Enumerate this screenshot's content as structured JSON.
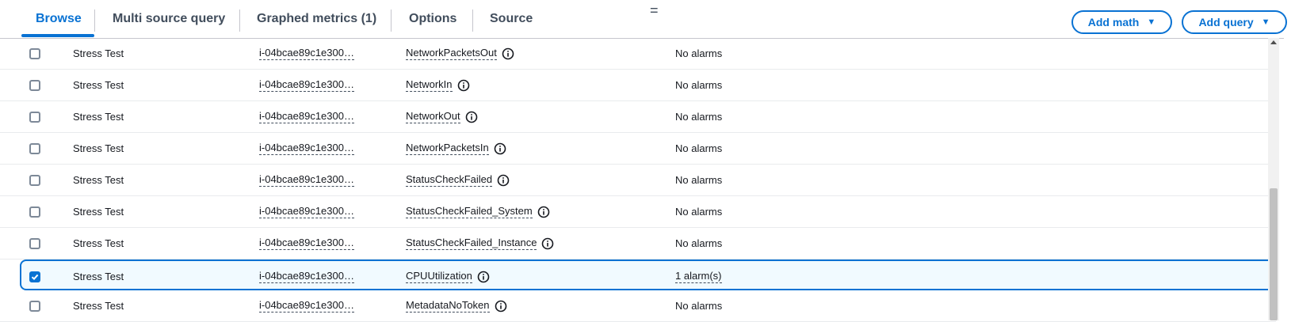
{
  "tabs": [
    {
      "label": "Browse",
      "active": true
    },
    {
      "label": "Multi source query",
      "active": false
    },
    {
      "label": "Graphed metrics (1)",
      "active": false
    },
    {
      "label": "Options",
      "active": false
    },
    {
      "label": "Source",
      "active": false
    }
  ],
  "drag_handle": "=",
  "buttons": {
    "add_math": "Add math",
    "add_query": "Add query",
    "caret": "▼"
  },
  "rows": [
    {
      "checked": false,
      "name": "Stress Test",
      "instance": "i-04bcae89c1e300…",
      "metric": "NetworkPacketsOut",
      "alarms": "No alarms"
    },
    {
      "checked": false,
      "name": "Stress Test",
      "instance": "i-04bcae89c1e300…",
      "metric": "NetworkIn",
      "alarms": "No alarms"
    },
    {
      "checked": false,
      "name": "Stress Test",
      "instance": "i-04bcae89c1e300…",
      "metric": "NetworkOut",
      "alarms": "No alarms"
    },
    {
      "checked": false,
      "name": "Stress Test",
      "instance": "i-04bcae89c1e300…",
      "metric": "NetworkPacketsIn",
      "alarms": "No alarms"
    },
    {
      "checked": false,
      "name": "Stress Test",
      "instance": "i-04bcae89c1e300…",
      "metric": "StatusCheckFailed",
      "alarms": "No alarms"
    },
    {
      "checked": false,
      "name": "Stress Test",
      "instance": "i-04bcae89c1e300…",
      "metric": "StatusCheckFailed_System",
      "alarms": "No alarms"
    },
    {
      "checked": false,
      "name": "Stress Test",
      "instance": "i-04bcae89c1e300…",
      "metric": "StatusCheckFailed_Instance",
      "alarms": "No alarms"
    },
    {
      "checked": true,
      "name": "Stress Test",
      "instance": "i-04bcae89c1e300…",
      "metric": "CPUUtilization",
      "alarms": "1 alarm(s)"
    },
    {
      "checked": false,
      "name": "Stress Test",
      "instance": "i-04bcae89c1e300…",
      "metric": "MetadataNoToken",
      "alarms": "No alarms"
    }
  ],
  "colors": {
    "accent": "#0972d3",
    "selected_row_bg": "#f1faff",
    "text": "#16191f"
  }
}
